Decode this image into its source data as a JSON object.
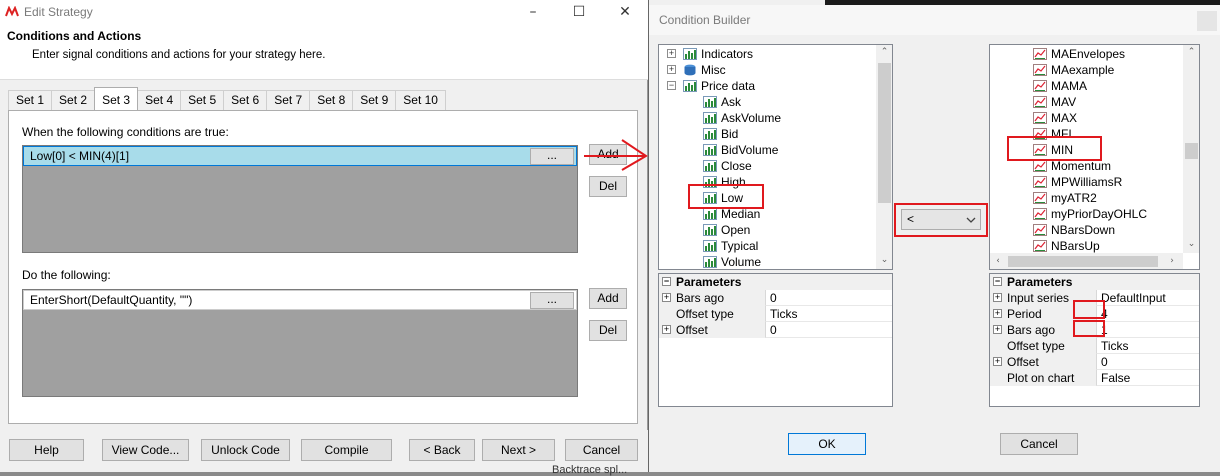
{
  "edit_strategy": {
    "title": "Edit Strategy",
    "header_title": "Conditions and Actions",
    "header_sub": "Enter signal conditions and actions for your strategy here.",
    "tabs": [
      "Set 1",
      "Set 2",
      "Set 3",
      "Set 4",
      "Set 5",
      "Set 6",
      "Set 7",
      "Set 8",
      "Set 9",
      "Set 10"
    ],
    "active_tab": "Set 3",
    "conditions_label": "When the following conditions are true:",
    "condition_value": "Low[0] < MIN(4)[1]",
    "actions_label": "Do the following:",
    "action_value": "EnterShort(DefaultQuantity, \"\")",
    "ellipsis": "...",
    "add_label": "Add",
    "del_label": "Del",
    "buttons": {
      "help": "Help",
      "view_code": "View Code...",
      "unlock_code": "Unlock Code",
      "compile": "Compile",
      "back": "< Back",
      "next": "Next >",
      "cancel": "Cancel"
    },
    "bottom_text": "Backtrace spl..."
  },
  "condition_builder": {
    "title": "Condition Builder",
    "left_tree": {
      "groups": [
        {
          "label": "Indicators",
          "expander": "+",
          "icon": "indicator-icon"
        },
        {
          "label": "Misc",
          "expander": "+",
          "icon": "misc-icon"
        },
        {
          "label": "Price data",
          "expander": "−",
          "icon": "indicator-icon"
        }
      ],
      "price_items": [
        "Ask",
        "AskVolume",
        "Bid",
        "BidVolume",
        "Close",
        "High",
        "Low",
        "Median",
        "Open",
        "Typical",
        "Volume"
      ],
      "selected": "Low"
    },
    "operator": "<",
    "right_tree": {
      "items": [
        "MAEnvelopes",
        "MAexample",
        "MAMA",
        "MAV",
        "MAX",
        "MFI",
        "MIN",
        "Momentum",
        "MPWilliamsR",
        "myATR2",
        "myPriorDayOHLC",
        "NBarsDown",
        "NBarsUp"
      ],
      "selected": "MIN"
    },
    "left_params": {
      "header": "Parameters",
      "rows": [
        {
          "name": "Bars ago",
          "value": "0",
          "expander": "+"
        },
        {
          "name": "Offset type",
          "value": "Ticks",
          "expander": ""
        },
        {
          "name": "Offset",
          "value": "0",
          "expander": "+"
        }
      ]
    },
    "right_params": {
      "header": "Parameters",
      "rows": [
        {
          "name": "Input series",
          "value": "DefaultInput",
          "expander": "+"
        },
        {
          "name": "Period",
          "value": "4",
          "expander": "+"
        },
        {
          "name": "Bars ago",
          "value": "1",
          "expander": "+"
        },
        {
          "name": "Offset type",
          "value": "Ticks",
          "expander": ""
        },
        {
          "name": "Offset",
          "value": "0",
          "expander": "+"
        },
        {
          "name": "Plot on chart",
          "value": "False",
          "expander": ""
        }
      ]
    },
    "ok_label": "OK",
    "cancel_label": "Cancel"
  },
  "colors": {
    "highlight_red": "#e0191e",
    "selected_row": "#a8dcea",
    "empty_list_bg": "#a0a0a0"
  }
}
